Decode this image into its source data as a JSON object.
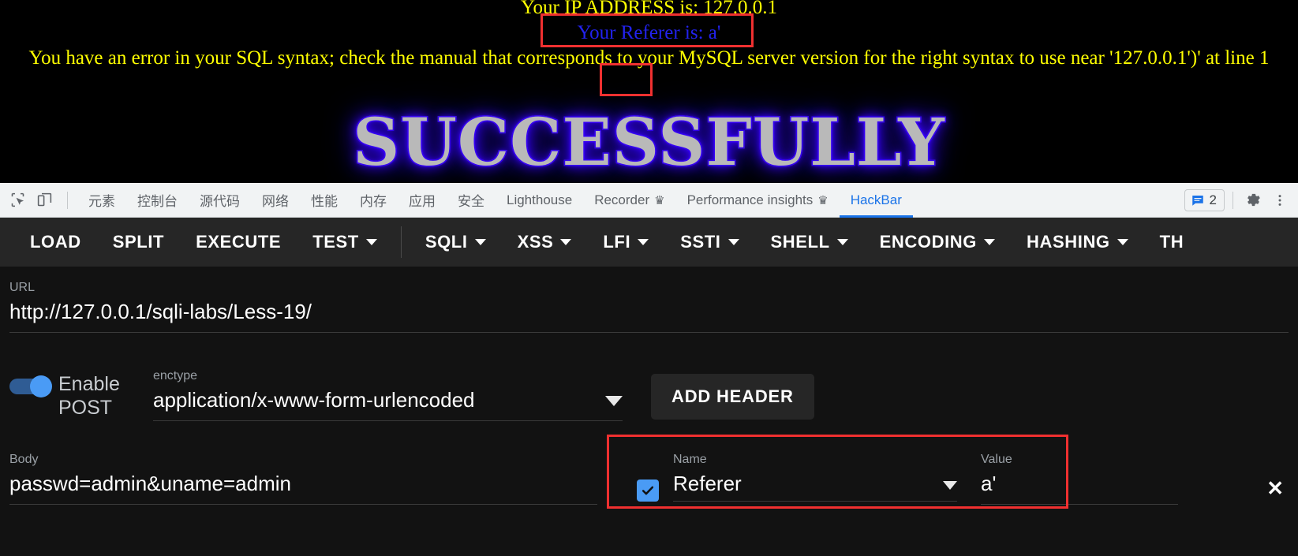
{
  "page": {
    "ip_line": "Your IP ADDRESS is: 127.0.0.1",
    "referer_line": "Your Referer is: a'",
    "error_line": "You have an error in your SQL syntax; check the manual that corresponds to your MySQL server version for the right syntax to use near '127.0.0.1')' at line 1",
    "banner": "SUCCESSFULLY",
    "colors": {
      "text": "#ffff00",
      "referer": "#2222ee",
      "annotation": "#f03030"
    }
  },
  "devtools": {
    "left_icons": [
      "inspect-element-icon",
      "device-toolbar-icon"
    ],
    "tabs": [
      {
        "label": "元素",
        "flask": false,
        "active": false
      },
      {
        "label": "控制台",
        "flask": false,
        "active": false
      },
      {
        "label": "源代码",
        "flask": false,
        "active": false
      },
      {
        "label": "网络",
        "flask": false,
        "active": false
      },
      {
        "label": "性能",
        "flask": false,
        "active": false
      },
      {
        "label": "内存",
        "flask": false,
        "active": false
      },
      {
        "label": "应用",
        "flask": false,
        "active": false
      },
      {
        "label": "安全",
        "flask": false,
        "active": false
      },
      {
        "label": "Lighthouse",
        "flask": false,
        "active": false
      },
      {
        "label": "Recorder",
        "flask": true,
        "active": false
      },
      {
        "label": "Performance insights",
        "flask": true,
        "active": false
      },
      {
        "label": "HackBar",
        "flask": false,
        "active": true
      }
    ],
    "issues_count": "2",
    "accent": "#1a73e8"
  },
  "hackbar": {
    "toolbar": [
      {
        "label": "LOAD",
        "caret": false
      },
      {
        "label": "SPLIT",
        "caret": false
      },
      {
        "label": "EXECUTE",
        "caret": false
      },
      {
        "label": "TEST",
        "caret": true
      },
      {
        "label": "SQLI",
        "caret": true
      },
      {
        "label": "XSS",
        "caret": true
      },
      {
        "label": "LFI",
        "caret": true
      },
      {
        "label": "SSTI",
        "caret": true
      },
      {
        "label": "SHELL",
        "caret": true
      },
      {
        "label": "ENCODING",
        "caret": true
      },
      {
        "label": "HASHING",
        "caret": true
      },
      {
        "label": "TH",
        "caret": false
      }
    ],
    "url": {
      "label": "URL",
      "value": "http://127.0.0.1/sqli-labs/Less-19/"
    },
    "post": {
      "toggle_label": "Enable POST",
      "toggle_on": true,
      "enctype_label": "enctype",
      "enctype_value": "application/x-www-form-urlencoded",
      "add_header_label": "ADD HEADER"
    },
    "body": {
      "label": "Body",
      "value": "passwd=admin&uname=admin"
    },
    "header_row": {
      "name_label": "Name",
      "name_value": "Referer",
      "value_label": "Value",
      "value_value": "a'",
      "checked": true,
      "remove_label": "✕"
    }
  }
}
